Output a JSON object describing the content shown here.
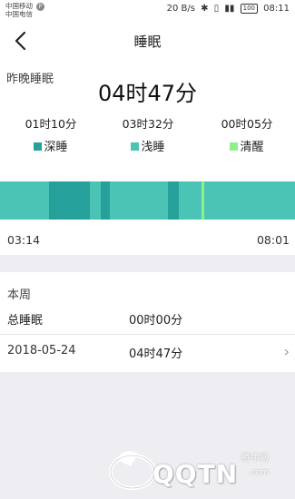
{
  "status_bar": {
    "carrier_1": "中国移动",
    "carrier_2": "中国电信",
    "carrier_badge": "P",
    "speed": "20 B/s",
    "battery": "100",
    "time": "08:11"
  },
  "header": {
    "title": "睡眠"
  },
  "summary": {
    "label": "昨晚睡眠",
    "total": "04时47分",
    "stats": [
      {
        "value": "01时10分",
        "legend": "深睡",
        "color": "#26a09a"
      },
      {
        "value": "03时32分",
        "legend": "浅睡",
        "color": "#4cc4b5"
      },
      {
        "value": "00时05分",
        "legend": "清醒",
        "color": "#8ef08a"
      }
    ],
    "start_time": "03:14",
    "end_time": "08:01"
  },
  "timeline": {
    "start": "03:14",
    "end": "08:01",
    "segments": [
      {
        "stage": "light",
        "from": "03:14",
        "to": "04:02"
      },
      {
        "stage": "deep",
        "from": "04:02",
        "to": "04:41"
      },
      {
        "stage": "light",
        "from": "04:41",
        "to": "04:52"
      },
      {
        "stage": "deep",
        "from": "04:52",
        "to": "05:01"
      },
      {
        "stage": "light",
        "from": "05:01",
        "to": "05:57"
      },
      {
        "stage": "deep",
        "from": "05:57",
        "to": "06:08"
      },
      {
        "stage": "light",
        "from": "06:08",
        "to": "06:30"
      },
      {
        "stage": "awake",
        "from": "06:30",
        "to": "06:33"
      },
      {
        "stage": "light",
        "from": "06:33",
        "to": "08:01"
      }
    ],
    "colors": {
      "deep": "#26a09a",
      "light": "#4cc4b5",
      "awake": "#8ef08a"
    }
  },
  "week": {
    "label": "本周",
    "total_label": "总睡眠",
    "total_value": "00时00分",
    "days": [
      {
        "date": "2018-05-24",
        "value": "04时47分"
      }
    ]
  },
  "watermark": {
    "text": "QQTN",
    "brand": "腾牛网",
    "domain": ".com"
  }
}
